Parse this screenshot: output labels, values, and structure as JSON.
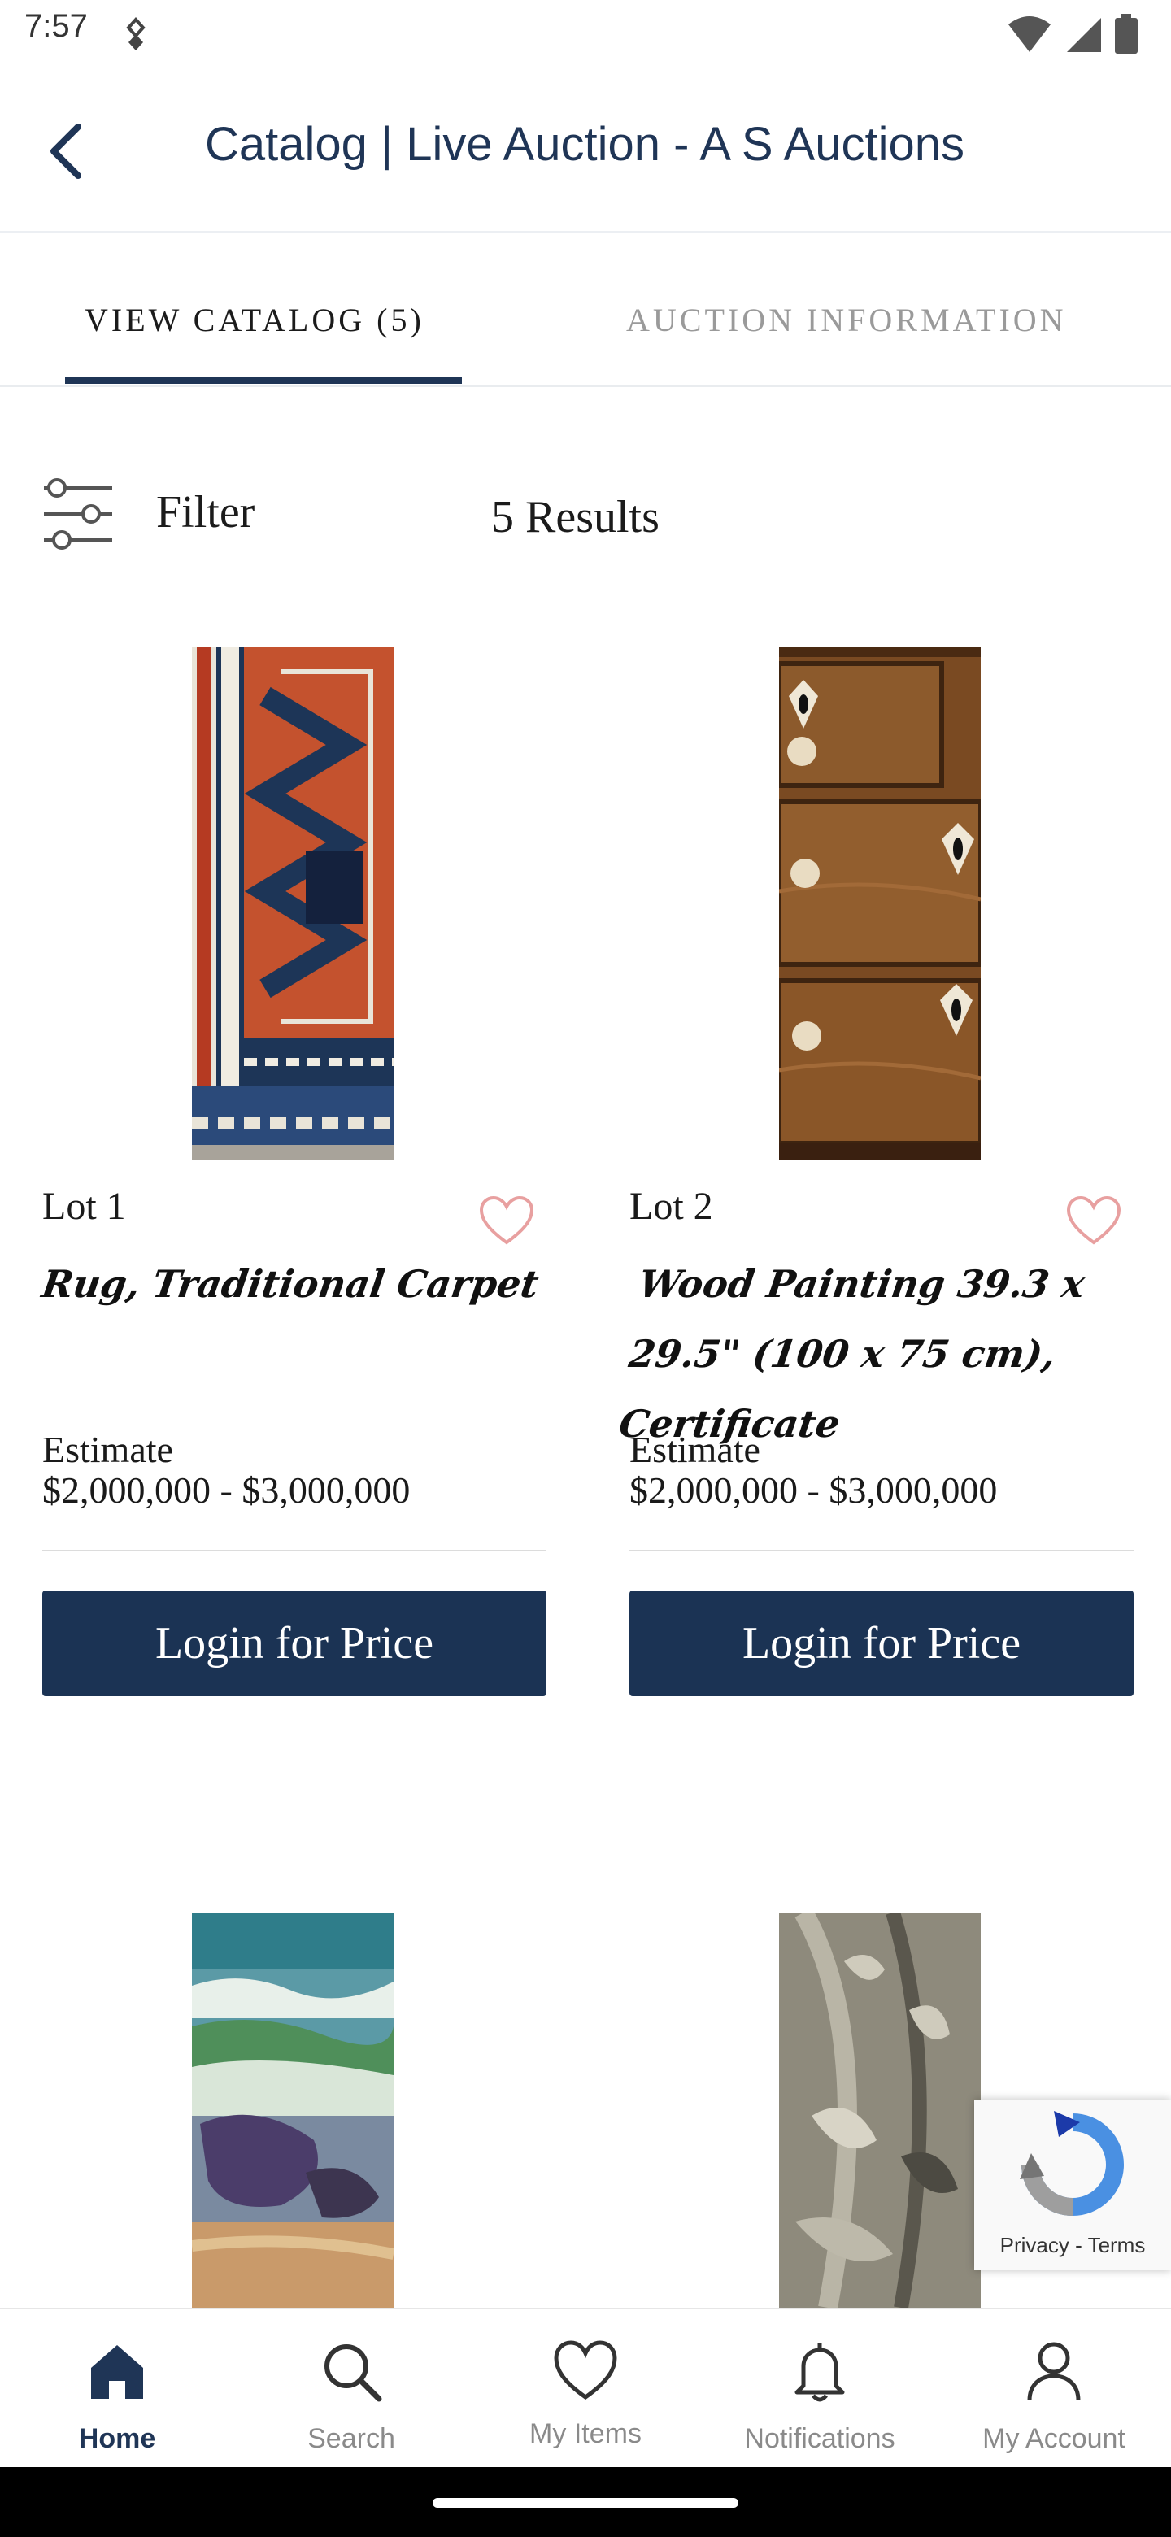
{
  "status_bar": {
    "time": "7:57"
  },
  "header": {
    "title": "Catalog | Live Auction - A S Auctions"
  },
  "tabs": [
    {
      "label": "VIEW CATALOG (5)",
      "active": true
    },
    {
      "label": "AUCTION INFORMATION",
      "active": false
    }
  ],
  "filter": {
    "label": "Filter",
    "results": "5 Results"
  },
  "lots": [
    {
      "lot": "Lot 1",
      "title": "Rug, Traditional Carpet",
      "estimate_label": "Estimate",
      "estimate": "$2,000,000 - $3,000,000",
      "button": "Login for Price",
      "image": "rug-image"
    },
    {
      "lot": "Lot 2",
      "title": "Wood Painting 39.3 x 29.5\" (100 x 75 cm), Certificate",
      "estimate_label": "Estimate",
      "estimate": "$2,000,000 - $3,000,000",
      "button": "Login for Price",
      "image": "wood-drawers-image"
    },
    {
      "image": "seascape-painting-image"
    },
    {
      "image": "silver-relief-image"
    }
  ],
  "recaptcha": {
    "privacy": "Privacy",
    "separator": "-",
    "terms": "Terms"
  },
  "bottom_nav": [
    {
      "label": "Home",
      "icon": "home-icon",
      "active": true
    },
    {
      "label": "Search",
      "icon": "search-icon"
    },
    {
      "label": "My Items",
      "icon": "heart-icon"
    },
    {
      "label": "Notifications",
      "icon": "bell-icon"
    },
    {
      "label": "My Account",
      "icon": "person-icon"
    }
  ],
  "colors": {
    "brand_navy": "#1b3354",
    "tab_inactive": "#9a9a9a",
    "heart": "#e8a0a0"
  }
}
